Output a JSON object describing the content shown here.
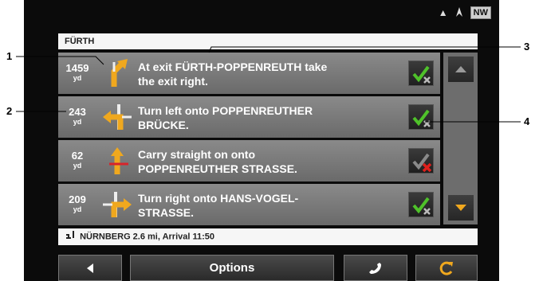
{
  "status": {
    "warning_symbol": "▲",
    "heading": "NW"
  },
  "header": {
    "title": "FÜRTH"
  },
  "instructions": [
    {
      "distance": "1459",
      "unit": "yd",
      "text_line1": "At exit FÜRTH-POPPENREUTH take",
      "text_line2": "the exit right.",
      "checked": true,
      "arrow": "exit-right-arrow-icon"
    },
    {
      "distance": "243",
      "unit": "yd",
      "text_line1": "Turn left onto POPPENREUTHER",
      "text_line2": "BRÜCKE.",
      "checked": true,
      "arrow": "turn-left-arrow-icon"
    },
    {
      "distance": "62",
      "unit": "yd",
      "text_line1": "Carry straight on onto",
      "text_line2": "POPPENREUTHER STRASSE.",
      "checked": false,
      "arrow": "straight-arrow-icon"
    },
    {
      "distance": "209",
      "unit": "yd",
      "text_line1": "Turn right onto HANS-VOGEL-",
      "text_line2": "STRASSE.",
      "checked": true,
      "arrow": "turn-right-arrow-icon"
    }
  ],
  "footer": {
    "text": "NÜRNBERG 2.6 mi, Arrival 11:50"
  },
  "buttons": {
    "options": "Options"
  },
  "callouts": {
    "c1": "1",
    "c2": "2",
    "c3": "3",
    "c4": "4"
  },
  "colors": {
    "arrow": "#f0a81e",
    "check_green": "#4fc22a",
    "cross_red": "#e0201c",
    "row": "#7a7a7a"
  }
}
